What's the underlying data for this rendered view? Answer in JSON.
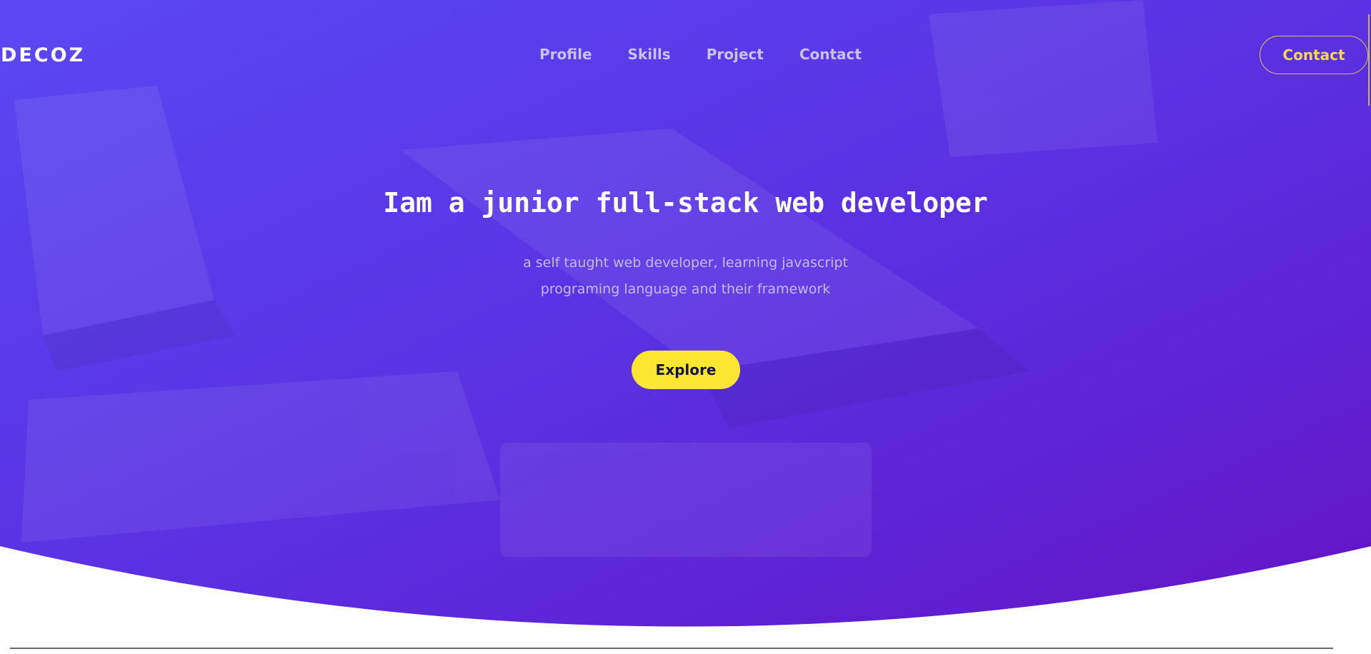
{
  "brand": {
    "name": "DECOZ"
  },
  "nav": {
    "items": [
      {
        "label": "Profile"
      },
      {
        "label": "Skills"
      },
      {
        "label": "Project"
      },
      {
        "label": "Contact"
      }
    ],
    "cta_label": "Contact"
  },
  "hero": {
    "title": "Iam a junior full-stack web developer",
    "subtitle_line1": "a self taught web developer, learning javascript",
    "subtitle_line2": "programing language and their framework",
    "button_label": "Explore"
  },
  "colors": {
    "gradient_start": "#5a46f2",
    "gradient_end": "#6416c9",
    "accent_yellow": "#fbe731",
    "nav_text": "#c9c2f5"
  }
}
